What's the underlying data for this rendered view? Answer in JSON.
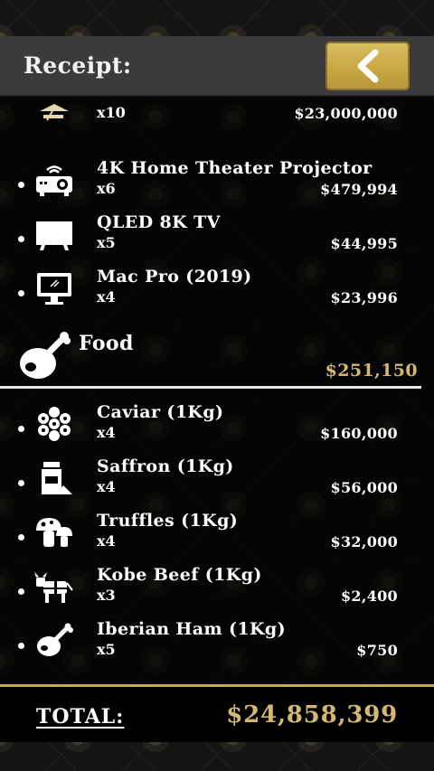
{
  "header": {
    "title": "Receipt:",
    "back_icon": "chevron-left-icon"
  },
  "items_top": [
    {
      "icon": "lamp-icon",
      "name": "",
      "qty": "x10",
      "price": "$23,000,000"
    },
    {
      "icon": "projector-icon",
      "name": "4K Home Theater Projector",
      "qty": "x6",
      "price": "$479,994"
    },
    {
      "icon": "tv-icon",
      "name": "QLED 8K TV",
      "qty": "x5",
      "price": "$44,995"
    },
    {
      "icon": "desktop-computer-icon",
      "name": "Mac Pro (2019)",
      "qty": "x4",
      "price": "$23,996"
    }
  ],
  "food": {
    "icon": "ham-leg-icon",
    "name": "Food",
    "total": "$251,150",
    "items": [
      {
        "icon": "caviar-icon",
        "name": "Caviar (1Kg)",
        "qty": "x4",
        "price": "$160,000"
      },
      {
        "icon": "saffron-jar-icon",
        "name": "Saffron (1Kg)",
        "qty": "x4",
        "price": "$56,000"
      },
      {
        "icon": "mushroom-icon",
        "name": "Truffles (1Kg)",
        "qty": "x4",
        "price": "$32,000"
      },
      {
        "icon": "cow-icon",
        "name": "Kobe Beef (1Kg)",
        "qty": "x3",
        "price": "$2,400"
      },
      {
        "icon": "ham-icon",
        "name": "Iberian Ham (1Kg)",
        "qty": "x5",
        "price": "$750"
      }
    ]
  },
  "total": {
    "label": "TOTAL:",
    "value": "$24,858,399"
  },
  "colors": {
    "gold": "#d4b872",
    "button_gold": "#c9a845",
    "header_bg": "#3b3b3b"
  }
}
